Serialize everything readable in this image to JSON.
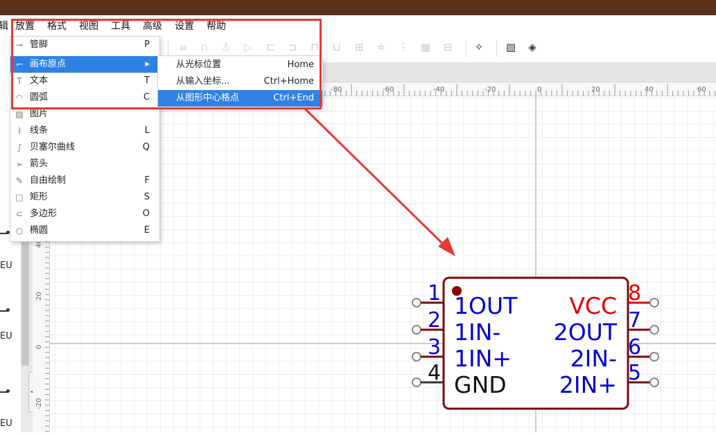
{
  "menubar": {
    "items": [
      "辑",
      "放置",
      "格式",
      "视图",
      "工具",
      "高级",
      "设置",
      "帮助"
    ]
  },
  "place_menu": {
    "items": [
      {
        "icon": "pin-icon",
        "glyph": "⊸",
        "label": "管脚",
        "key": "P"
      },
      {
        "icon": "origin-icon",
        "glyph": "⌐",
        "label": "画布原点",
        "key": "▸",
        "active": true
      },
      {
        "icon": "text-icon",
        "glyph": "T",
        "label": "文本",
        "key": "T"
      },
      {
        "icon": "arc-icon",
        "glyph": "◠",
        "label": "圆弧",
        "key": "C"
      },
      {
        "icon": "image-icon",
        "glyph": "▨",
        "label": "图片",
        "key": ""
      },
      {
        "icon": "line-icon",
        "glyph": "⌇",
        "label": "线条",
        "key": "L"
      },
      {
        "icon": "bezier-icon",
        "glyph": "∫",
        "label": "贝塞尔曲线",
        "key": "Q"
      },
      {
        "icon": "arrow-icon",
        "glyph": "➢",
        "label": "箭头",
        "key": ""
      },
      {
        "icon": "pencil-icon",
        "glyph": "✎",
        "label": "自由绘制",
        "key": "F"
      },
      {
        "icon": "rectangle-icon",
        "glyph": "□",
        "label": "矩形",
        "key": "S"
      },
      {
        "icon": "polygon-icon",
        "glyph": "⊂",
        "label": "多边形",
        "key": "O"
      },
      {
        "icon": "ellipse-icon",
        "glyph": "○",
        "label": "椭圆",
        "key": "E"
      }
    ]
  },
  "origin_submenu": {
    "items": [
      {
        "label": "从光标位置",
        "key": "Home"
      },
      {
        "label": "从输入坐标...",
        "key": "Ctrl+Home"
      },
      {
        "label": "从图形中心格点",
        "key": "Ctrl+End",
        "active": true
      }
    ]
  },
  "ruler": {
    "h_ticks": [
      "-80",
      "-60",
      "-40",
      "-20",
      "0",
      "20",
      "40",
      "60"
    ],
    "v_ticks": [
      "40",
      "20",
      "0",
      "-20"
    ]
  },
  "side_panel": {
    "labels": [
      "EU",
      "EU",
      "EU"
    ]
  },
  "symbol": {
    "left_pins": [
      {
        "num": "1",
        "name": "1OUT"
      },
      {
        "num": "2",
        "name": "1IN-"
      },
      {
        "num": "3",
        "name": "1IN+"
      },
      {
        "num": "4",
        "name": "GND"
      }
    ],
    "right_pins": [
      {
        "num": "8",
        "name": "VCC"
      },
      {
        "num": "7",
        "name": "2OUT"
      },
      {
        "num": "6",
        "name": "2IN-"
      },
      {
        "num": "5",
        "name": "2IN+"
      }
    ]
  },
  "colors": {
    "titlebar": "#5b2f18",
    "menu_active": "#2f82e4",
    "highlight": "#e53935",
    "pin_name_blue": "#0000d0",
    "pin_name_red": "#e00000",
    "body_outline": "#7a0a0a"
  }
}
